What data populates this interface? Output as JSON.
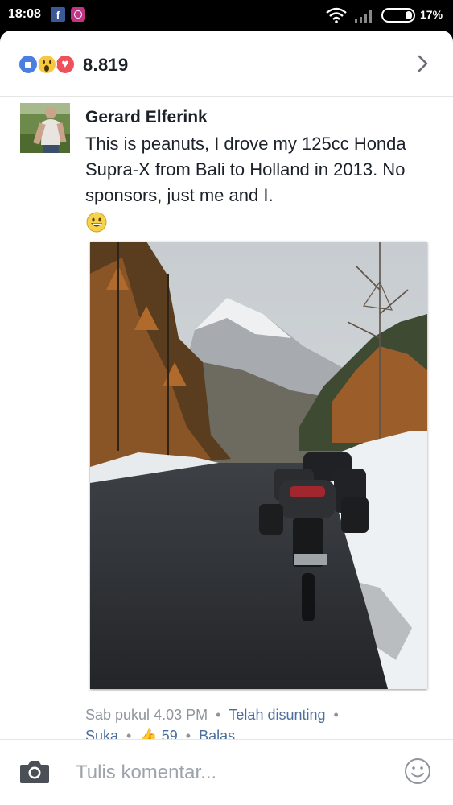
{
  "status_bar": {
    "time": "18:08",
    "battery": "17%",
    "icons": [
      "facebook-icon",
      "instagram-icon",
      "wifi-icon",
      "signal-icon",
      "battery-icon"
    ]
  },
  "reactions": {
    "icons": [
      "like-icon",
      "wow-icon",
      "love-icon"
    ],
    "count": "8.819"
  },
  "comment": {
    "author": "Gerard Elferink",
    "text": "This is peanuts, I drove my 125cc Honda Supra-X from Bali to Holland in 2013. No sponsors, just me and I.",
    "emoji": "smiley-emoji",
    "photo": "motorbike-on-snowy-mountain-road",
    "timestamp": "Sab pukul 4.03 PM",
    "separator": "•",
    "edited": "Telah disunting",
    "like_label": "Suka",
    "like_count": "59",
    "reply_label": "Balas"
  },
  "composer": {
    "placeholder": "Tulis komentar...",
    "icons": [
      "camera-icon",
      "smiley-icon"
    ]
  },
  "colors": {
    "link": "#4b6e9c",
    "meta": "#90949c",
    "text": "#1d2129",
    "like": "#4a7fe0",
    "wow": "#f5c842",
    "love": "#f0505a"
  }
}
